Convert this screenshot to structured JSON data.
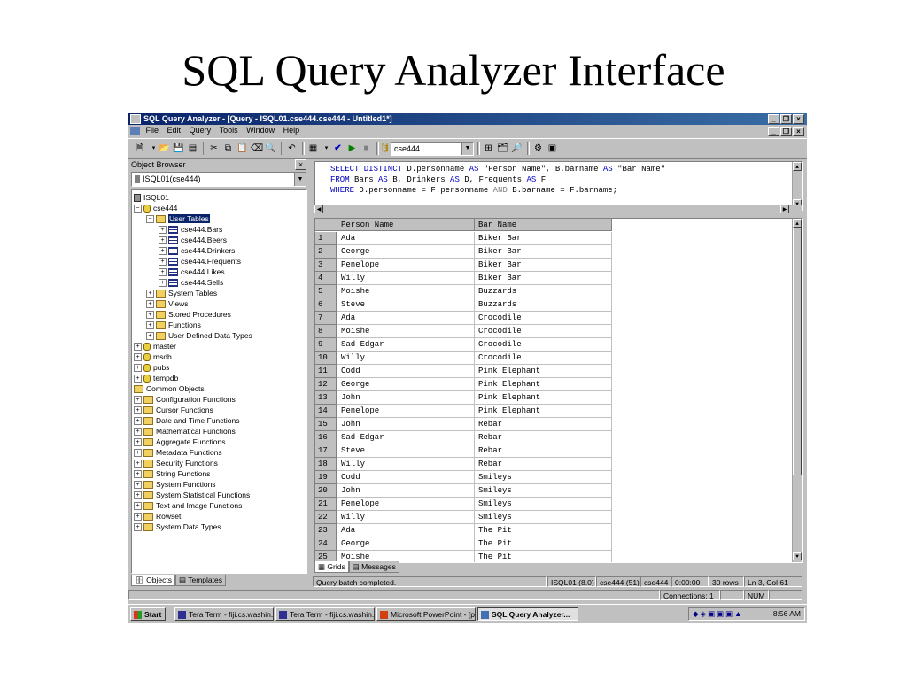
{
  "slide": {
    "title": "SQL Query Analyzer Interface"
  },
  "window": {
    "title": "SQL Query Analyzer - [Query - ISQL01.cse444.cse444 - Untitled1*]",
    "controls": [
      "_",
      "❐",
      "×"
    ]
  },
  "menu": {
    "items": [
      "File",
      "Edit",
      "Query",
      "Tools",
      "Window",
      "Help"
    ]
  },
  "toolbar": {
    "database": "cse444"
  },
  "object_browser": {
    "label": "Object Browser",
    "server_select": "ISQL01(cse444)",
    "tree": [
      {
        "label": "ISQL01",
        "icon": "server-icon"
      },
      {
        "label": "cse444",
        "icon": "database-icon"
      },
      {
        "label": "User Tables",
        "icon": "folder-icon"
      },
      {
        "label": "cse444.Bars",
        "icon": "table-icon"
      },
      {
        "label": "cse444.Beers",
        "icon": "table-icon"
      },
      {
        "label": "cse444.Drinkers",
        "icon": "table-icon"
      },
      {
        "label": "cse444.Frequents",
        "icon": "table-icon"
      },
      {
        "label": "cse444.Likes",
        "icon": "table-icon"
      },
      {
        "label": "cse444.Sells",
        "icon": "table-icon"
      },
      {
        "label": "System Tables",
        "icon": "folder-icon"
      },
      {
        "label": "Views",
        "icon": "folder-icon"
      },
      {
        "label": "Stored Procedures",
        "icon": "folder-icon"
      },
      {
        "label": "Functions",
        "icon": "folder-icon"
      },
      {
        "label": "User Defined Data Types",
        "icon": "folder-icon"
      },
      {
        "label": "master",
        "icon": "database-icon"
      },
      {
        "label": "msdb",
        "icon": "database-icon"
      },
      {
        "label": "pubs",
        "icon": "database-icon"
      },
      {
        "label": "tempdb",
        "icon": "database-icon"
      },
      {
        "label": "Common Objects",
        "icon": "folder-icon"
      },
      {
        "label": "Configuration Functions",
        "icon": "folder-icon"
      },
      {
        "label": "Cursor Functions",
        "icon": "folder-icon"
      },
      {
        "label": "Date and Time Functions",
        "icon": "folder-icon"
      },
      {
        "label": "Mathematical Functions",
        "icon": "folder-icon"
      },
      {
        "label": "Aggregate Functions",
        "icon": "folder-icon"
      },
      {
        "label": "Metadata Functions",
        "icon": "folder-icon"
      },
      {
        "label": "Security Functions",
        "icon": "folder-icon"
      },
      {
        "label": "String Functions",
        "icon": "folder-icon"
      },
      {
        "label": "System Functions",
        "icon": "folder-icon"
      },
      {
        "label": "System Statistical Functions",
        "icon": "folder-icon"
      },
      {
        "label": "Text and Image Functions",
        "icon": "folder-icon"
      },
      {
        "label": "Rowset",
        "icon": "folder-icon"
      },
      {
        "label": "System Data Types",
        "icon": "folder-icon"
      }
    ],
    "tabs": [
      "Objects",
      "Templates"
    ]
  },
  "query": {
    "lines": [
      [
        {
          "t": "SELECT DISTINCT",
          "k": "kw"
        },
        {
          "t": " D.personname ",
          "k": ""
        },
        {
          "t": "AS",
          "k": "kw"
        },
        {
          "t": " \"Person Name\", B.barname ",
          "k": ""
        },
        {
          "t": "AS",
          "k": "kw"
        },
        {
          "t": " \"Bar Name\"",
          "k": ""
        }
      ],
      [
        {
          "t": "FROM",
          "k": "kw"
        },
        {
          "t": " Bars ",
          "k": ""
        },
        {
          "t": "AS",
          "k": "kw"
        },
        {
          "t": " B, Drinkers ",
          "k": ""
        },
        {
          "t": "AS",
          "k": "kw"
        },
        {
          "t": " D, Frequents ",
          "k": ""
        },
        {
          "t": "AS",
          "k": "kw"
        },
        {
          "t": " F",
          "k": ""
        }
      ],
      [
        {
          "t": "WHERE",
          "k": "kw"
        },
        {
          "t": " D.personname = F.personname ",
          "k": ""
        },
        {
          "t": "AND",
          "k": "kwg"
        },
        {
          "t": " B.barname = F.barname;",
          "k": ""
        }
      ]
    ]
  },
  "results": {
    "columns": [
      "Person Name",
      "Bar Name"
    ],
    "rows": [
      [
        "1",
        "Ada",
        "Biker Bar"
      ],
      [
        "2",
        "George",
        "Biker Bar"
      ],
      [
        "3",
        "Penelope",
        "Biker Bar"
      ],
      [
        "4",
        "Willy",
        "Biker Bar"
      ],
      [
        "5",
        "Moishe",
        "Buzzards"
      ],
      [
        "6",
        "Steve",
        "Buzzards"
      ],
      [
        "7",
        "Ada",
        "Crocodile"
      ],
      [
        "8",
        "Moishe",
        "Crocodile"
      ],
      [
        "9",
        "Sad Edgar",
        "Crocodile"
      ],
      [
        "10",
        "Willy",
        "Crocodile"
      ],
      [
        "11",
        "Codd",
        "Pink Elephant"
      ],
      [
        "12",
        "George",
        "Pink Elephant"
      ],
      [
        "13",
        "John",
        "Pink Elephant"
      ],
      [
        "14",
        "Penelope",
        "Pink Elephant"
      ],
      [
        "15",
        "John",
        "Rebar"
      ],
      [
        "16",
        "Sad Edgar",
        "Rebar"
      ],
      [
        "17",
        "Steve",
        "Rebar"
      ],
      [
        "18",
        "Willy",
        "Rebar"
      ],
      [
        "19",
        "Codd",
        "Smileys"
      ],
      [
        "20",
        "John",
        "Smileys"
      ],
      [
        "21",
        "Penelope",
        "Smileys"
      ],
      [
        "22",
        "Willy",
        "Smileys"
      ],
      [
        "23",
        "Ada",
        "The Pit"
      ],
      [
        "24",
        "George",
        "The Pit"
      ],
      [
        "25",
        "Moishe",
        "The Pit"
      ]
    ],
    "tabs": [
      "Grids",
      "Messages"
    ]
  },
  "status": {
    "message": "Query batch completed.",
    "server": "ISQL01 (8.0)",
    "user": "cse444 (51)",
    "db": "cse444",
    "time": "0:00:00",
    "rows": "30 rows",
    "position": "Ln 3, Col 61",
    "connections": "Connections: 1",
    "num": "NUM"
  },
  "taskbar": {
    "start": "Start",
    "buttons": [
      "Tera Term - fiji.cs.washin...",
      "Tera Term - fiji.cs.washin...",
      "Microsoft PowerPoint - [p...",
      "SQL Query Analyzer..."
    ],
    "clock": "8:56 AM"
  },
  "colors": {
    "titlebar": "#0a246a",
    "keyword": "#0000c0",
    "selection": "#0a246a",
    "chrome": "#c0c0c0"
  }
}
